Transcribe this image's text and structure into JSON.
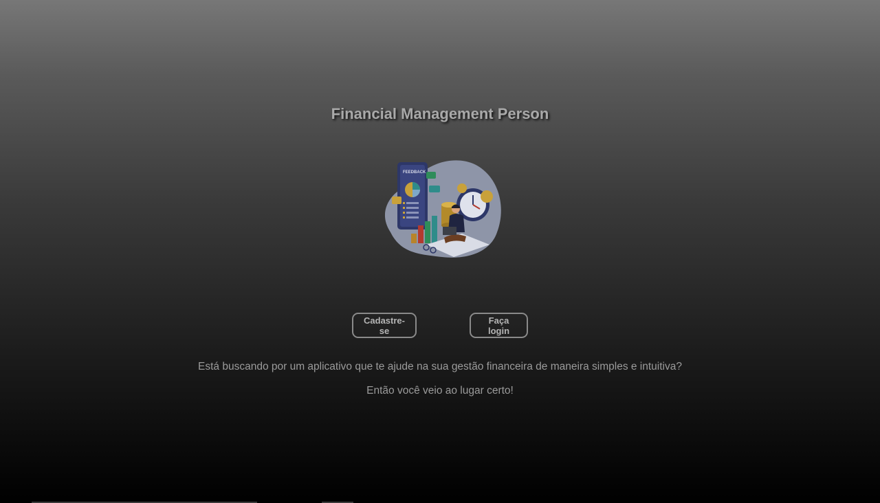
{
  "header": {
    "title": "Financial Management Person"
  },
  "hero": {
    "icon": "finance-illustration",
    "badge_text": "FEEDBACK"
  },
  "actions": {
    "signup_label": "Cadastre-se",
    "login_label": "Faça login"
  },
  "intro": {
    "line1": "Está buscando por um aplicativo que te ajude na sua gestão financeira de maneira simples e intuitiva?",
    "line2": "Então você veio ao lugar certo!"
  },
  "colors": {
    "background_top": "#777777",
    "background_bottom": "#000000",
    "text": "#9b9b9b",
    "button_border": "#8a8a8a"
  }
}
